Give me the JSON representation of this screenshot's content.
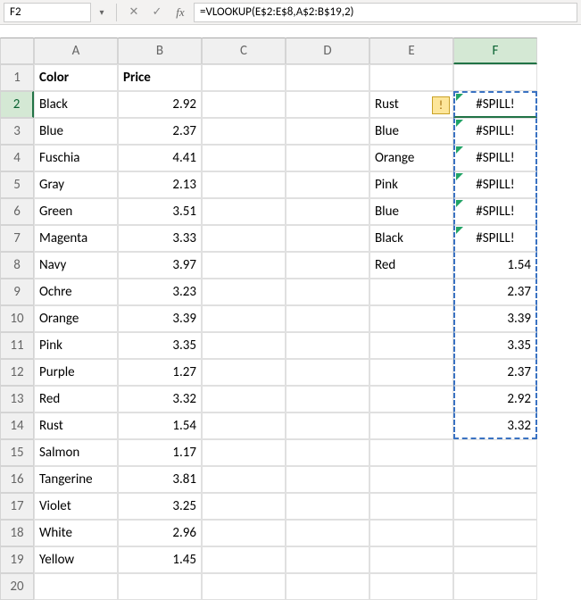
{
  "namebox": "F2",
  "formula": "=VLOOKUP(E$2:E$8,A$2:B$19,2)",
  "columns": [
    "A",
    "B",
    "C",
    "D",
    "E",
    "F"
  ],
  "rows": [
    "1",
    "2",
    "3",
    "4",
    "5",
    "6",
    "7",
    "8",
    "9",
    "10",
    "11",
    "12",
    "13",
    "14",
    "15",
    "16",
    "17",
    "18",
    "19",
    "20"
  ],
  "headers": {
    "A": "Color",
    "B": "Price"
  },
  "colA": [
    "Black",
    "Blue",
    "Fuschia",
    "Gray",
    "Green",
    "Magenta",
    "Navy",
    "Ochre",
    "Orange",
    "Pink",
    "Purple",
    "Red",
    "Rust",
    "Salmon",
    "Tangerine",
    "Violet",
    "White",
    "Yellow"
  ],
  "colB": [
    "2.92",
    "2.37",
    "4.41",
    "2.13",
    "3.51",
    "3.33",
    "3.97",
    "3.23",
    "3.39",
    "3.35",
    "1.27",
    "3.32",
    "1.54",
    "1.17",
    "3.81",
    "3.25",
    "2.96",
    "1.45"
  ],
  "colE": [
    "Rust",
    "Blue",
    "Orange",
    "Pink",
    "Blue",
    "Black",
    "Red"
  ],
  "colF": [
    "#SPILL!",
    "#SPILL!",
    "#SPILL!",
    "#SPILL!",
    "#SPILL!",
    "#SPILL!",
    "1.54",
    "2.37",
    "3.39",
    "3.35",
    "2.37",
    "2.92",
    "3.32"
  ],
  "icons": {
    "dropdown": "▾",
    "cancel": "✕",
    "check": "✓",
    "warn": "!"
  },
  "fx": "fx",
  "chart_data": {
    "type": "table",
    "title": "Spreadsheet with VLOOKUP spill errors",
    "formula": "=VLOOKUP(E$2:E$8,A$2:B$19,2)",
    "active_cell": "F2",
    "data_table": {
      "headers": [
        "Color",
        "Price"
      ],
      "rows": [
        [
          "Black",
          2.92
        ],
        [
          "Blue",
          2.37
        ],
        [
          "Fuschia",
          4.41
        ],
        [
          "Gray",
          2.13
        ],
        [
          "Green",
          3.51
        ],
        [
          "Magenta",
          3.33
        ],
        [
          "Navy",
          3.97
        ],
        [
          "Ochre",
          3.23
        ],
        [
          "Orange",
          3.39
        ],
        [
          "Pink",
          3.35
        ],
        [
          "Purple",
          1.27
        ],
        [
          "Red",
          3.32
        ],
        [
          "Rust",
          1.54
        ],
        [
          "Salmon",
          1.17
        ],
        [
          "Tangerine",
          3.81
        ],
        [
          "Violet",
          3.25
        ],
        [
          "White",
          2.96
        ],
        [
          "Yellow",
          1.45
        ]
      ]
    },
    "lookup_column_E": [
      "Rust",
      "Blue",
      "Orange",
      "Pink",
      "Blue",
      "Black",
      "Red"
    ],
    "result_column_F": [
      "#SPILL!",
      "#SPILL!",
      "#SPILL!",
      "#SPILL!",
      "#SPILL!",
      "#SPILL!",
      1.54,
      2.37,
      3.39,
      3.35,
      2.37,
      2.92,
      3.32
    ]
  }
}
